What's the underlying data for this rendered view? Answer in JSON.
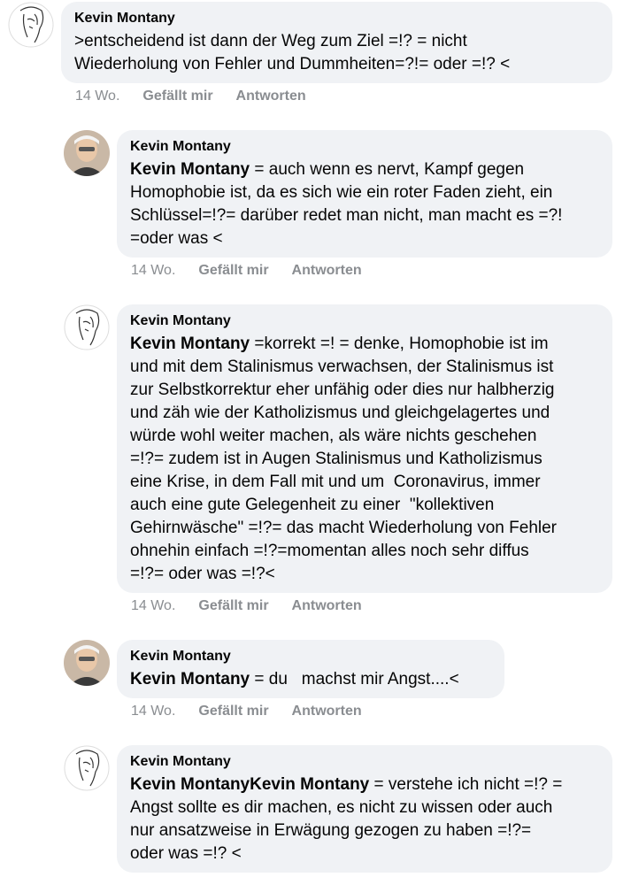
{
  "comments": [
    {
      "author": "Kevin Montany",
      "mention": "",
      "text": ">entscheidend ist dann der Weg zum Ziel =!? = nicht\nWiederholung von Fehler und Dummheiten=?!= oder =!? <",
      "time": "14 Wo.",
      "like": "Gefällt mir",
      "reply": "Antworten",
      "avatar": "sketch-face"
    },
    {
      "author": "Kevin Montany",
      "mention": "Kevin Montany",
      "text": " = auch wenn es nervt, Kampf gegen\nHomophobie ist, da es sich wie ein roter Faden zieht, ein\nSchlüssel=!?= darüber redet man nicht, man macht es =?!\n=oder was <",
      "time": "14 Wo.",
      "like": "Gefällt mir",
      "reply": "Antworten",
      "avatar": "photo-person"
    },
    {
      "author": "Kevin Montany",
      "mention": "Kevin Montany",
      "text": " =korrekt =! = denke, Homophobie ist im\nund mit dem Stalinismus verwachsen, der Stalinismus ist\nzur Selbstkorrektur eher unfähig oder dies nur halbherzig\nund zäh wie der Katholizismus und gleichgelagertes und\nwürde wohl weiter machen, als wäre nichts geschehen\n=!?= zudem ist in Augen Stalinismus und Katholizismus\neine Krise, in dem Fall mit und um  Coronavirus, immer\nauch eine gute Gelegenheit zu einer  \"kollektiven\nGehirnwäsche\" =!?= das macht Wiederholung von Fehler\nohnehin einfach =!?=momentan alles noch sehr diffus\n=!?= oder was =!?<",
      "time": "14 Wo.",
      "like": "Gefällt mir",
      "reply": "Antworten",
      "avatar": "sketch-face"
    },
    {
      "author": "Kevin Montany",
      "mention": "Kevin Montany",
      "text": " = du   machst mir Angst....<",
      "time": "14 Wo.",
      "like": "Gefällt mir",
      "reply": "Antworten",
      "avatar": "photo-person"
    },
    {
      "author": "Kevin Montany",
      "mention": "Kevin MontanyKevin Montany",
      "text": " = verstehe ich nicht =!? =\nAngst sollte es dir machen, es nicht zu wissen oder auch\nnur ansatzweise in Erwägung gezogen zu haben =!?=\noder was =!? <",
      "time": "",
      "like": "",
      "reply": "",
      "avatar": "sketch-face"
    }
  ]
}
